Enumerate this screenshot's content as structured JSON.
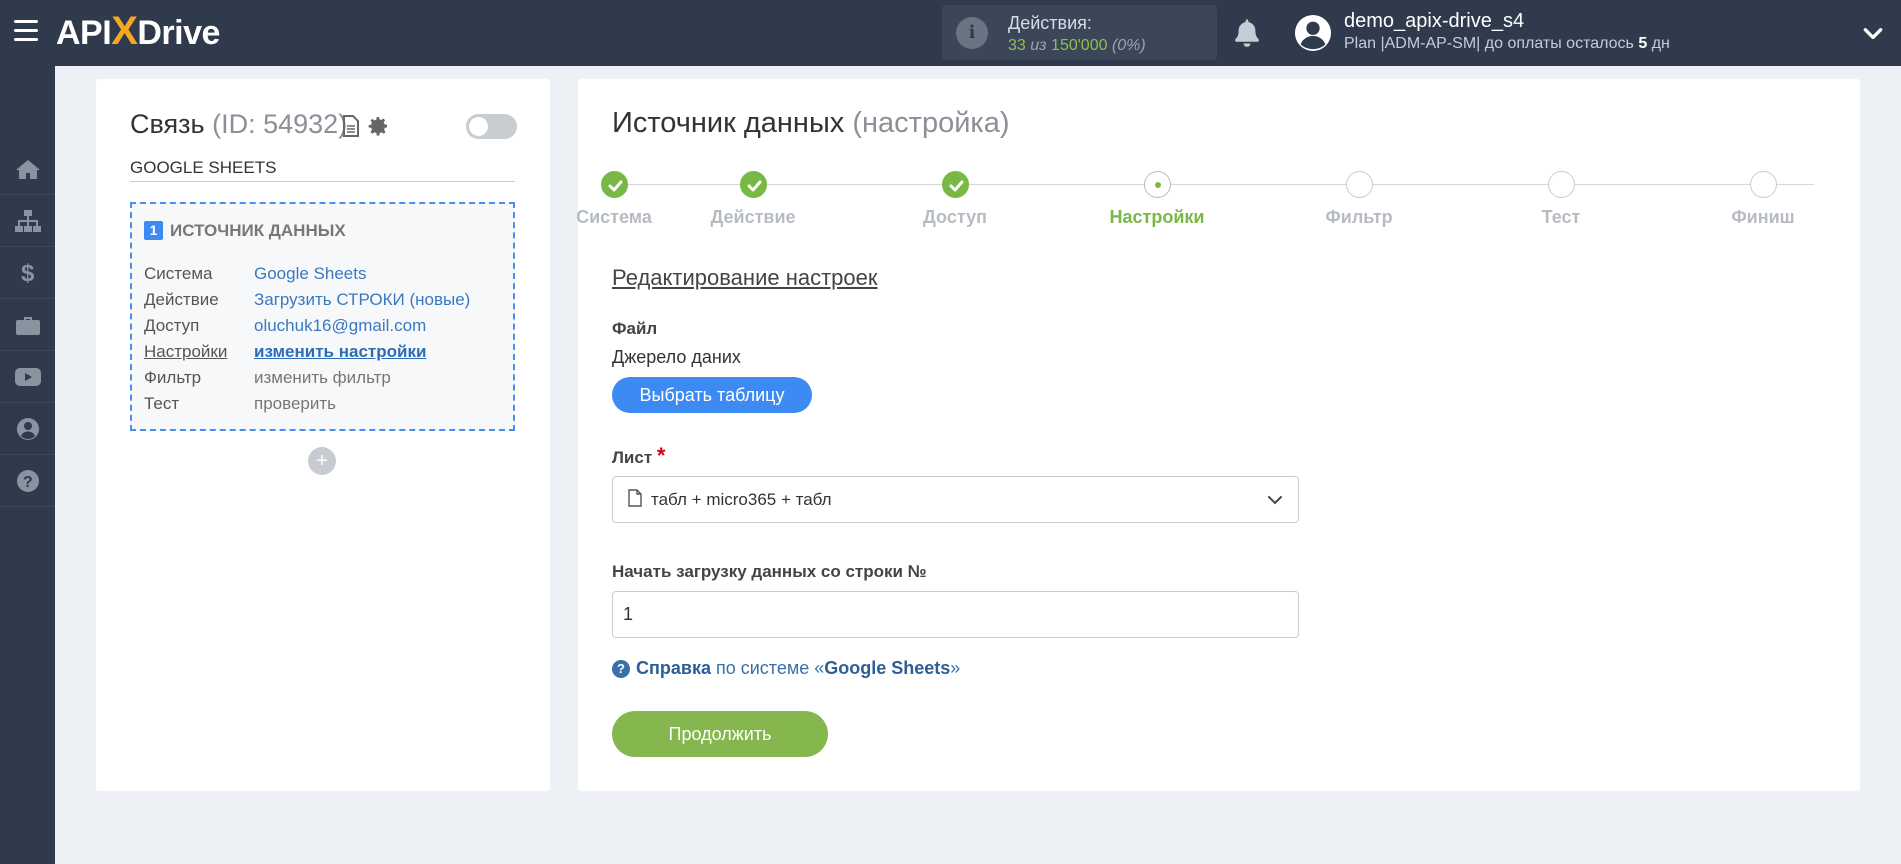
{
  "header": {
    "logo": {
      "part1": "API",
      "part2": "X",
      "part3": "Drive"
    },
    "actions": {
      "title": "Действия:",
      "used": "33",
      "of": "из",
      "total": "150'000",
      "percent": "(0%)"
    },
    "user": {
      "name": "demo_apix-drive_s4",
      "plan_prefix": "Plan |ADM-AP-SM| до оплаты осталось",
      "days": "5",
      "days_suffix": "дн"
    }
  },
  "sidebar": {
    "items": [
      {
        "icon": "home-icon"
      },
      {
        "icon": "sitemap-icon"
      },
      {
        "icon": "dollar-icon"
      },
      {
        "icon": "briefcase-icon"
      },
      {
        "icon": "youtube-icon"
      },
      {
        "icon": "user-circle-icon"
      },
      {
        "icon": "question-circle-icon"
      }
    ]
  },
  "connection": {
    "title": "Связь",
    "id_text": "(ID: 54932)",
    "name": "GOOGLE SHEETS",
    "source": {
      "badge": "1",
      "title": "ИСТОЧНИК ДАННЫХ",
      "rows": [
        {
          "label": "Система",
          "value": "Google Sheets"
        },
        {
          "label": "Действие",
          "value": "Загрузить СТРОКИ (новые)"
        },
        {
          "label": "Доступ",
          "value": "oluchuk16@gmail.com"
        },
        {
          "label": "Настройки",
          "value": "изменить настройки"
        },
        {
          "label": "Фильтр",
          "value": "изменить фильтр"
        },
        {
          "label": "Тест",
          "value": "проверить"
        }
      ]
    },
    "add": "+"
  },
  "main": {
    "title": "Источник данных",
    "subtitle": "(настройка)",
    "steps": [
      {
        "label": "Система",
        "state": "done"
      },
      {
        "label": "Действие",
        "state": "done"
      },
      {
        "label": "Доступ",
        "state": "done"
      },
      {
        "label": "Настройки",
        "state": "active"
      },
      {
        "label": "Фильтр",
        "state": "pending"
      },
      {
        "label": "Тест",
        "state": "pending"
      },
      {
        "label": "Финиш",
        "state": "pending"
      }
    ],
    "section_title": "Редактирование настроек",
    "file_label": "Файл",
    "file_source": "Джерело даних",
    "choose_table_button": "Выбрать таблицу",
    "sheet_label": "Лист",
    "required_mark": "*",
    "sheet_value": "табл + micro365 + табл",
    "start_row_label": "Начать загрузку данных со строки №",
    "start_row_value": "1",
    "help": {
      "link": "Справка",
      "mid": "по системе «",
      "system": "Google Sheets",
      "end": "»"
    },
    "continue_button": "Продолжить"
  },
  "colors": {
    "topbar": "#2f3b4d",
    "accent_blue": "#3d8bf2",
    "accent_green": "#78b844",
    "continue_green": "#86b74e",
    "background": "#edf1f6"
  }
}
